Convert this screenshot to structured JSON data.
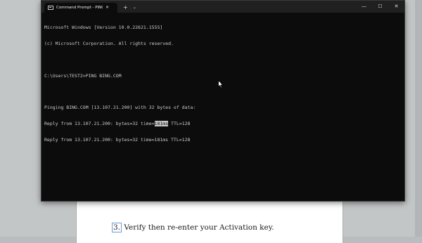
{
  "terminal": {
    "tab_title": "Command Prompt - PING BIN",
    "new_tab": "+",
    "dropdown": "⌄",
    "lines": {
      "l1": "Microsoft Windows [Version 10.0.22621.1555]",
      "l2": "(c) Microsoft Corporation. All rights reserved.",
      "l3": "",
      "l4": "C:\\Users\\TEST2>PING BING.COM",
      "l5": "",
      "l6": "Pinging BING.COM [13.107.21.200] with 32 bytes of data:",
      "l7_pre": "Reply from 13.107.21.200: bytes=32 time=",
      "l7_sel": "181ms",
      "l7_post": " TTL=128",
      "l8": "Reply from 13.107.21.200: bytes=32 time=181ms TTL=128"
    }
  },
  "document": {
    "step_number": "3.",
    "step_text": " Verify  then re-enter your Activation key."
  }
}
